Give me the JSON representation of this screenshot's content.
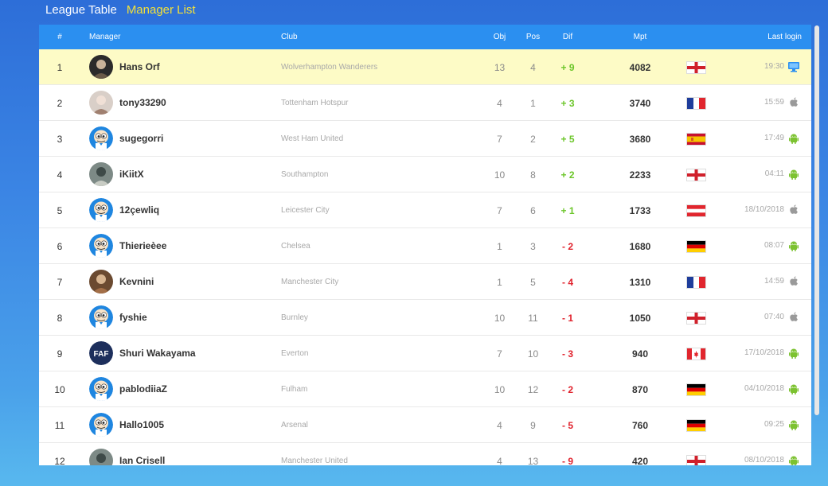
{
  "tabs": [
    {
      "label": "League Table",
      "active": false
    },
    {
      "label": "Manager List",
      "active": true
    }
  ],
  "headers": {
    "rank": "#",
    "manager": "Manager",
    "club": "Club",
    "obj": "Obj",
    "pos": "Pos",
    "dif": "Dif",
    "mpt": "Mpt",
    "last_login": "Last login"
  },
  "colors": {
    "up": "#6cc62a",
    "down": "#e0202b",
    "highlight": "#fdfbc6",
    "header": "#2b8ff0"
  },
  "rows": [
    {
      "rank": "1",
      "name": "Hans Orf",
      "club": "Wolverhampton Wanderers",
      "obj": "13",
      "pos": "4",
      "dif": "+ 9",
      "mpt": "4082",
      "flag": "england-flag",
      "login": "19:30",
      "device": "desktop-icon",
      "avatar": "photo-dark",
      "highlight": true
    },
    {
      "rank": "2",
      "name": "tony33290",
      "club": "Tottenham Hotspur",
      "obj": "4",
      "pos": "1",
      "dif": "+ 3",
      "mpt": "3740",
      "flag": "france-flag",
      "login": "15:59",
      "device": "apple-icon",
      "avatar": "photo-light"
    },
    {
      "rank": "3",
      "name": "sugegorri",
      "club": "West Ham United",
      "obj": "7",
      "pos": "2",
      "dif": "+ 5",
      "mpt": "3680",
      "flag": "spain-flag",
      "login": "17:49",
      "device": "android-icon",
      "avatar": "mascot"
    },
    {
      "rank": "4",
      "name": "iKiitX",
      "club": "Southampton",
      "obj": "10",
      "pos": "8",
      "dif": "+ 2",
      "mpt": "2233",
      "flag": "england-flag",
      "login": "04:11",
      "device": "android-icon",
      "avatar": "photo-grey"
    },
    {
      "rank": "5",
      "name": "12çewliq",
      "club": "Leicester City",
      "obj": "7",
      "pos": "6",
      "dif": "+ 1",
      "mpt": "1733",
      "flag": "austria-flag",
      "login": "18/10/2018",
      "device": "apple-icon",
      "avatar": "mascot"
    },
    {
      "rank": "6",
      "name": "Thierieèee",
      "club": "Chelsea",
      "obj": "1",
      "pos": "3",
      "dif": "- 2",
      "mpt": "1680",
      "flag": "germany-flag",
      "login": "08:07",
      "device": "android-icon",
      "avatar": "mascot"
    },
    {
      "rank": "7",
      "name": "Kevnini",
      "club": "Manchester City",
      "obj": "1",
      "pos": "5",
      "dif": "- 4",
      "mpt": "1310",
      "flag": "france-flag",
      "login": "14:59",
      "device": "apple-icon",
      "avatar": "photo-brown"
    },
    {
      "rank": "8",
      "name": "fyshie",
      "club": "Burnley",
      "obj": "10",
      "pos": "11",
      "dif": "- 1",
      "mpt": "1050",
      "flag": "england-flag",
      "login": "07:40",
      "device": "apple-icon",
      "avatar": "mascot"
    },
    {
      "rank": "9",
      "name": "Shuri Wakayama",
      "club": "Everton",
      "obj": "7",
      "pos": "10",
      "dif": "- 3",
      "mpt": "940",
      "flag": "canada-flag",
      "login": "17/10/2018",
      "device": "android-icon",
      "avatar": "logo-text",
      "avatar_text": "FAF"
    },
    {
      "rank": "10",
      "name": "pablodiiaZ",
      "club": "Fulham",
      "obj": "10",
      "pos": "12",
      "dif": "- 2",
      "mpt": "870",
      "flag": "germany-flag",
      "login": "04/10/2018",
      "device": "android-icon",
      "avatar": "mascot"
    },
    {
      "rank": "11",
      "name": "Hallo1005",
      "club": "Arsenal",
      "obj": "4",
      "pos": "9",
      "dif": "- 5",
      "mpt": "760",
      "flag": "germany-flag",
      "login": "09:25",
      "device": "android-icon",
      "avatar": "mascot"
    },
    {
      "rank": "12",
      "name": "Ian Crisell",
      "club": "Manchester United",
      "obj": "4",
      "pos": "13",
      "dif": "- 9",
      "mpt": "420",
      "flag": "england-flag",
      "login": "08/10/2018",
      "device": "android-icon",
      "avatar": "photo-grey"
    }
  ]
}
